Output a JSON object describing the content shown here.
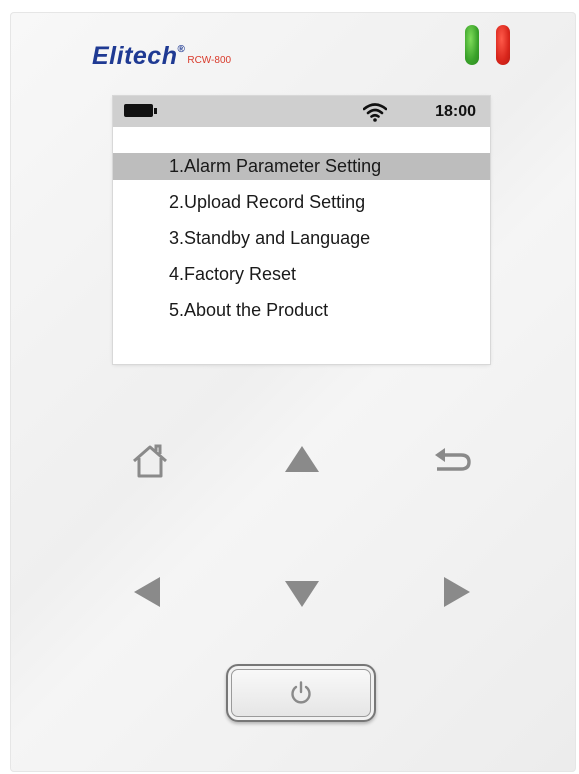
{
  "brand": {
    "name": "Elitech",
    "registered": "®",
    "model": "RCW-800"
  },
  "indicators": {
    "green_led_color": "#3aa22a",
    "red_led_color": "#d9261c"
  },
  "status_bar": {
    "battery_icon": "battery-full-icon",
    "wifi_icon": "wifi-icon",
    "time": "18:00"
  },
  "menu": {
    "selected_index": 0,
    "items": [
      {
        "label": "1.Alarm Parameter Setting"
      },
      {
        "label": "2.Upload Record Setting"
      },
      {
        "label": "3.Standby and Language"
      },
      {
        "label": "4.Factory Reset"
      },
      {
        "label": "5.About the Product"
      }
    ]
  },
  "keypad": {
    "home_icon": "home-icon",
    "up_icon": "arrow-up-icon",
    "back_icon": "back-icon",
    "left_icon": "arrow-left-icon",
    "down_icon": "arrow-down-icon",
    "right_icon": "arrow-right-icon",
    "power_icon": "power-icon"
  },
  "colors": {
    "brand_blue": "#1f3a93",
    "model_red": "#d93a2b",
    "highlight_gray": "#bdbdbd",
    "key_gray": "#8a8a8a"
  }
}
